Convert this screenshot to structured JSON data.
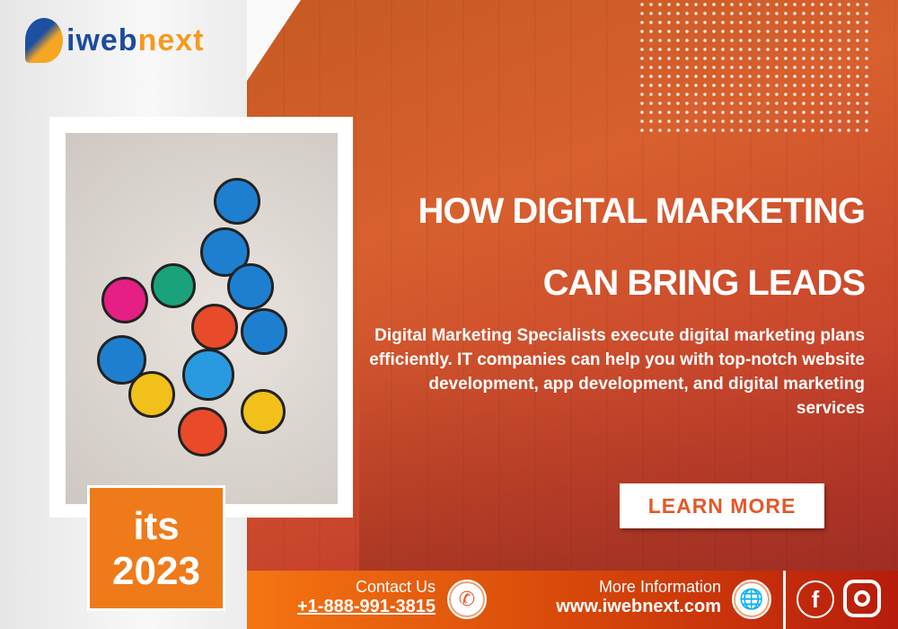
{
  "brand": {
    "logo_text": "iwebnext",
    "accent": "#e4582a"
  },
  "headline": {
    "line1": "HOW DIGITAL MARKETING",
    "line2": "CAN BRING LEADS"
  },
  "body": "Digital Marketing Specialists execute digital marketing plans efficiently. IT companies can help you with top-notch website development, app development, and digital marketing services",
  "cta": "LEARN MORE",
  "badge": {
    "line1": "its",
    "line2": "2023"
  },
  "footer": {
    "contact_label": "Contact Us",
    "phone": "+1-888-991-3815",
    "info_label": "More Information",
    "website": "www.iwebnext.com",
    "icons": [
      "phone-icon",
      "globe-icon",
      "facebook-icon",
      "instagram-icon"
    ]
  }
}
